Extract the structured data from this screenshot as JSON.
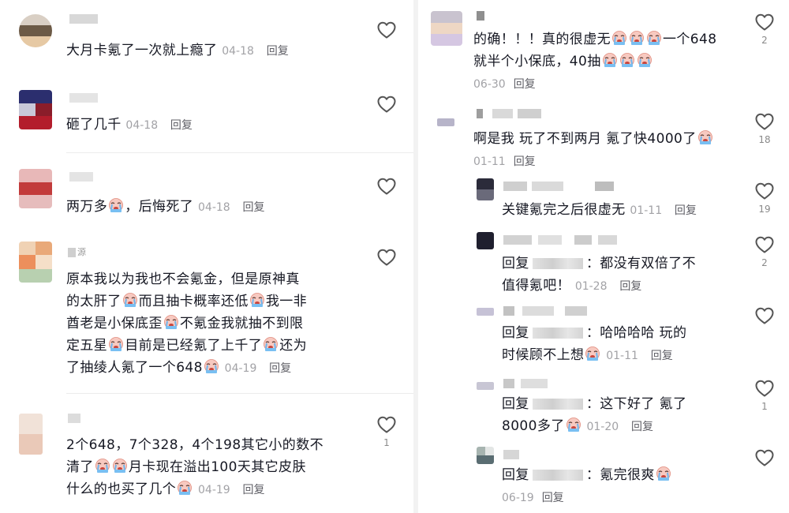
{
  "left": {
    "comments": [
      {
        "text": "大月卡氪了一次就上瘾了",
        "date": "04-18",
        "reply": "回复",
        "likes": ""
      },
      {
        "text": "砸了几千",
        "date": "04-18",
        "reply": "回复",
        "likes": ""
      },
      {
        "text_a": "两万多",
        "text_b": "，后悔死了",
        "date": "04-18",
        "reply": "回复",
        "likes": ""
      },
      {
        "user": "源",
        "lines": [
          "原本我以为我也不会氪金，但是原神真",
          "的太肝了",
          "而且抽卡概率还低",
          "我一非",
          "酋老是小保底歪",
          "不氪金我就抽不到限",
          "定五星",
          "目前是已经氪了上千了",
          "还为",
          "了抽绫人氪了一个648"
        ],
        "date": "04-19",
        "reply": "回复",
        "likes": ""
      },
      {
        "lines": [
          "2个648，7个328，4个198其它小的数不",
          "清了",
          "月卡现在溢出100天其它皮肤",
          "什么的也买了几个"
        ],
        "date": "04-19",
        "reply": "回复",
        "likes": "1"
      }
    ]
  },
  "right": {
    "comments": [
      {
        "lines": [
          "的确！！！真的很虚无",
          "一个648",
          "就半个小保底，40抽"
        ],
        "date": "06-30",
        "reply": "回复",
        "likes": "2"
      },
      {
        "text": "啊是我 玩了不到两月 氪了快4000了",
        "date": "01-11",
        "reply": "回复",
        "likes": "18"
      },
      {
        "text": "关键氪完之后很虚无",
        "date": "01-11",
        "reply": "回复",
        "likes": "19"
      },
      {
        "prefix": "回复",
        "tail": "：都没有双倍了不",
        "line2": "值得氪吧！",
        "date": "01-28",
        "reply": "回复",
        "likes": "2"
      },
      {
        "prefix": "回复",
        "tail": "：哈哈哈哈 玩的",
        "line2": "时候顾不上想",
        "date": "01-11",
        "reply": "回复",
        "likes": ""
      },
      {
        "prefix": "回复",
        "tail": "：这下好了 氪了",
        "line2": "8000多了",
        "date": "01-20",
        "reply": "回复",
        "likes": "1"
      },
      {
        "prefix": "回复",
        "tail": "：氪完很爽",
        "date": "06-19",
        "reply": "回复",
        "likes": ""
      }
    ]
  },
  "colors": {
    "text": "#161823",
    "meta": "#a2a2a6",
    "reply": "#5f5f66",
    "heart": "#555555",
    "divider": "#ececec"
  },
  "icons": {
    "like": "heart-outline-icon",
    "emoji": "crying-face-emoji-icon"
  }
}
